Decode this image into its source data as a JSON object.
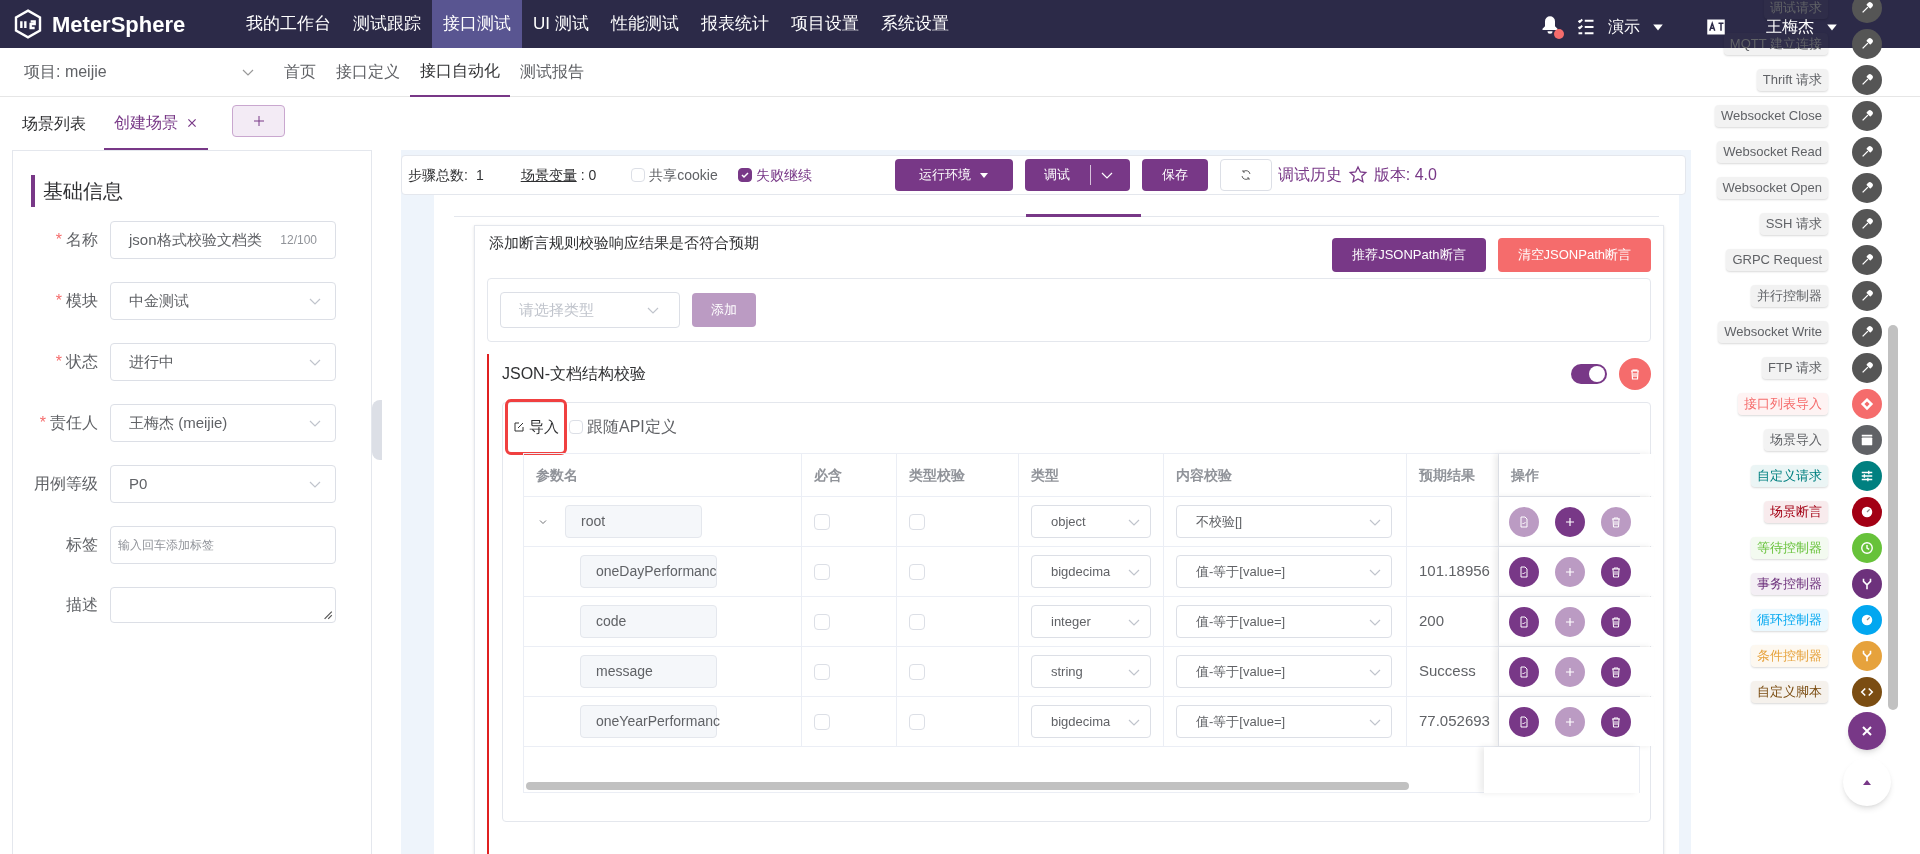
{
  "header": {
    "logo": "MeterSphere",
    "nav": [
      {
        "label": "我的工作台",
        "selected": false
      },
      {
        "label": "测试跟踪",
        "selected": false
      },
      {
        "label": "接口测试",
        "selected": true
      },
      {
        "label": "UI 测试",
        "selected": false
      },
      {
        "label": "性能测试",
        "selected": false
      },
      {
        "label": "报表统计",
        "selected": false
      },
      {
        "label": "项目设置",
        "selected": false
      },
      {
        "label": "系统设置",
        "selected": false
      }
    ],
    "has_notification": true,
    "workspace": "演示",
    "user": "王梅杰"
  },
  "subnav": {
    "project": "项目: meijie",
    "tabs": [
      {
        "label": "首页",
        "selected": false
      },
      {
        "label": "接口定义",
        "selected": false
      },
      {
        "label": "接口自动化",
        "selected": true
      },
      {
        "label": "测试报告",
        "selected": false
      }
    ]
  },
  "scene_tabs": [
    {
      "label": "场景列表",
      "selected": false,
      "closable": false
    },
    {
      "label": "创建场景",
      "selected": true,
      "closable": true
    }
  ],
  "basic_info": {
    "title": "基础信息",
    "fields": [
      {
        "label": "名称",
        "required_mark": "*",
        "kind": "text",
        "value": "json格式校验文档类",
        "counter": "12/100"
      },
      {
        "label": "模块",
        "required_mark": "*",
        "kind": "select",
        "value": "中金测试"
      },
      {
        "label": "状态",
        "required_mark": "*",
        "kind": "select",
        "value": "进行中"
      },
      {
        "label": "责任人",
        "required_mark": "*",
        "kind": "select",
        "value": "王梅杰 (meijie)"
      },
      {
        "label": "用例等级",
        "kind": "select",
        "value": "P0"
      },
      {
        "label": "标签",
        "kind": "tags",
        "placeholder": "输入回车添加标签"
      },
      {
        "label": "描述",
        "kind": "textarea"
      }
    ]
  },
  "toolbar": {
    "step_count_label": "步骤总数:",
    "step_count": "1",
    "variables_label": "场景变量",
    "variables_count": ": 0",
    "share_cookie": {
      "label": "共享cookie",
      "checked": false
    },
    "continue_on_fail": {
      "label": "失败继续",
      "checked": true
    },
    "env_button": "运行环境",
    "debug_button": "调试",
    "save_button": "保存",
    "history_link": "调试历史",
    "version": "版本: 4.0"
  },
  "assertion": {
    "hint": "添加断言规则校验响应结果是否符合预期",
    "recommend_button": "推荐JSONPath断言",
    "clear_button": "清空JSONPath断言",
    "type_placeholder": "请选择类型",
    "add_button": "添加",
    "add_disabled": true,
    "document": {
      "title": "JSON-文档结构校验",
      "enabled": true,
      "import_button": "导入",
      "import_highlighted": true,
      "follow_api": {
        "label": "跟随API定义",
        "checked": false
      },
      "columns": [
        "参数名",
        "必含",
        "类型校验",
        "类型",
        "内容校验",
        "预期结果",
        "操作"
      ],
      "rows": [
        {
          "name": "root",
          "expanded": true,
          "required": false,
          "type_check": false,
          "type": "object",
          "content_check": "不校验[]",
          "ops": {
            "check_enabled": false,
            "add_enabled": true,
            "delete_enabled": false
          },
          "children": [
            {
              "name": "oneDayPerformanc",
              "required": false,
              "type_check": false,
              "type": "bigdecima",
              "content_check": "值-等于[value=]",
              "expected": "101.18956",
              "ops": {
                "check_enabled": true,
                "add_enabled": false,
                "delete_enabled": true
              }
            },
            {
              "name": "code",
              "required": false,
              "type_check": false,
              "type": "integer",
              "content_check": "值-等于[value=]",
              "expected": "200",
              "ops": {
                "check_enabled": true,
                "add_enabled": false,
                "delete_enabled": true
              }
            },
            {
              "name": "message",
              "required": false,
              "type_check": false,
              "type": "string",
              "content_check": "值-等于[value=]",
              "expected": "Success",
              "ops": {
                "check_enabled": true,
                "add_enabled": false,
                "delete_enabled": true
              }
            },
            {
              "name": "oneYearPerformanc",
              "required": false,
              "type_check": false,
              "type": "bigdecima",
              "content_check": "值-等于[value=]",
              "expected": "77.052693",
              "ops": {
                "check_enabled": true,
                "add_enabled": false,
                "delete_enabled": true
              }
            }
          ]
        }
      ]
    }
  },
  "step_menu": [
    {
      "label": "调试请求",
      "kind": "request",
      "color": "#555555"
    },
    {
      "label": "MQTT 建立连接",
      "kind": "request",
      "color": "#555555"
    },
    {
      "label": "Thrift 请求",
      "kind": "request",
      "color": "#555555"
    },
    {
      "label": "Websocket Close",
      "kind": "request",
      "color": "#555555"
    },
    {
      "label": "Websocket Read",
      "kind": "request",
      "color": "#555555"
    },
    {
      "label": "Websocket Open",
      "kind": "request",
      "color": "#555555"
    },
    {
      "label": "SSH 请求",
      "kind": "request",
      "color": "#555555"
    },
    {
      "label": "GRPC Request",
      "kind": "request",
      "color": "#555555"
    },
    {
      "label": "并行控制器",
      "kind": "request",
      "color": "#555555"
    },
    {
      "label": "Websocket Write",
      "kind": "request",
      "color": "#555555"
    },
    {
      "label": "FTP 请求",
      "kind": "request",
      "color": "#555555"
    },
    {
      "label": "接口列表导入",
      "kind": "import",
      "color": "#f56c6c"
    },
    {
      "label": "场景导入",
      "kind": "scene",
      "color": "#606266"
    },
    {
      "label": "自定义请求",
      "kind": "custom",
      "color": "#008080"
    },
    {
      "label": "场景断言",
      "kind": "gauge",
      "color": "#a30014"
    },
    {
      "label": "等待控制器",
      "kind": "clock",
      "color": "#67c23a"
    },
    {
      "label": "事务控制器",
      "kind": "branch",
      "color": "#6d317c"
    },
    {
      "label": "循环控制器",
      "kind": "gauge",
      "color": "#02a7f0"
    },
    {
      "label": "条件控制器",
      "kind": "branch",
      "color": "#e6a23c"
    },
    {
      "label": "自定义脚本",
      "kind": "code",
      "color": "#7b4d12"
    }
  ]
}
